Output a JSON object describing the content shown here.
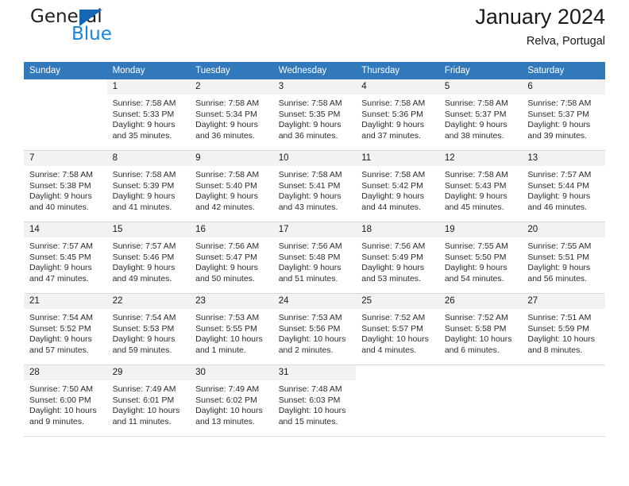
{
  "brand": {
    "name_top": "General",
    "name_bottom": "Blue",
    "triangle_color": "#1567b2",
    "blue_color": "#1a86d8",
    "dark_color": "#231f20"
  },
  "header": {
    "title": "January 2024",
    "subtitle": "Relva, Portugal"
  },
  "theme": {
    "header_band": "#3279bb",
    "daynum_band": "#f2f2f2",
    "row_divider": "#d9d9d9",
    "text": "#1a1a1a"
  },
  "weekdays": [
    "Sunday",
    "Monday",
    "Tuesday",
    "Wednesday",
    "Thursday",
    "Friday",
    "Saturday"
  ],
  "weeks": [
    [
      {
        "blank": true
      },
      {
        "day": "1",
        "sunrise": "Sunrise: 7:58 AM",
        "sunset": "Sunset: 5:33 PM",
        "daylight1": "Daylight: 9 hours",
        "daylight2": "and 35 minutes."
      },
      {
        "day": "2",
        "sunrise": "Sunrise: 7:58 AM",
        "sunset": "Sunset: 5:34 PM",
        "daylight1": "Daylight: 9 hours",
        "daylight2": "and 36 minutes."
      },
      {
        "day": "3",
        "sunrise": "Sunrise: 7:58 AM",
        "sunset": "Sunset: 5:35 PM",
        "daylight1": "Daylight: 9 hours",
        "daylight2": "and 36 minutes."
      },
      {
        "day": "4",
        "sunrise": "Sunrise: 7:58 AM",
        "sunset": "Sunset: 5:36 PM",
        "daylight1": "Daylight: 9 hours",
        "daylight2": "and 37 minutes."
      },
      {
        "day": "5",
        "sunrise": "Sunrise: 7:58 AM",
        "sunset": "Sunset: 5:37 PM",
        "daylight1": "Daylight: 9 hours",
        "daylight2": "and 38 minutes."
      },
      {
        "day": "6",
        "sunrise": "Sunrise: 7:58 AM",
        "sunset": "Sunset: 5:37 PM",
        "daylight1": "Daylight: 9 hours",
        "daylight2": "and 39 minutes."
      }
    ],
    [
      {
        "day": "7",
        "sunrise": "Sunrise: 7:58 AM",
        "sunset": "Sunset: 5:38 PM",
        "daylight1": "Daylight: 9 hours",
        "daylight2": "and 40 minutes."
      },
      {
        "day": "8",
        "sunrise": "Sunrise: 7:58 AM",
        "sunset": "Sunset: 5:39 PM",
        "daylight1": "Daylight: 9 hours",
        "daylight2": "and 41 minutes."
      },
      {
        "day": "9",
        "sunrise": "Sunrise: 7:58 AM",
        "sunset": "Sunset: 5:40 PM",
        "daylight1": "Daylight: 9 hours",
        "daylight2": "and 42 minutes."
      },
      {
        "day": "10",
        "sunrise": "Sunrise: 7:58 AM",
        "sunset": "Sunset: 5:41 PM",
        "daylight1": "Daylight: 9 hours",
        "daylight2": "and 43 minutes."
      },
      {
        "day": "11",
        "sunrise": "Sunrise: 7:58 AM",
        "sunset": "Sunset: 5:42 PM",
        "daylight1": "Daylight: 9 hours",
        "daylight2": "and 44 minutes."
      },
      {
        "day": "12",
        "sunrise": "Sunrise: 7:58 AM",
        "sunset": "Sunset: 5:43 PM",
        "daylight1": "Daylight: 9 hours",
        "daylight2": "and 45 minutes."
      },
      {
        "day": "13",
        "sunrise": "Sunrise: 7:57 AM",
        "sunset": "Sunset: 5:44 PM",
        "daylight1": "Daylight: 9 hours",
        "daylight2": "and 46 minutes."
      }
    ],
    [
      {
        "day": "14",
        "sunrise": "Sunrise: 7:57 AM",
        "sunset": "Sunset: 5:45 PM",
        "daylight1": "Daylight: 9 hours",
        "daylight2": "and 47 minutes."
      },
      {
        "day": "15",
        "sunrise": "Sunrise: 7:57 AM",
        "sunset": "Sunset: 5:46 PM",
        "daylight1": "Daylight: 9 hours",
        "daylight2": "and 49 minutes."
      },
      {
        "day": "16",
        "sunrise": "Sunrise: 7:56 AM",
        "sunset": "Sunset: 5:47 PM",
        "daylight1": "Daylight: 9 hours",
        "daylight2": "and 50 minutes."
      },
      {
        "day": "17",
        "sunrise": "Sunrise: 7:56 AM",
        "sunset": "Sunset: 5:48 PM",
        "daylight1": "Daylight: 9 hours",
        "daylight2": "and 51 minutes."
      },
      {
        "day": "18",
        "sunrise": "Sunrise: 7:56 AM",
        "sunset": "Sunset: 5:49 PM",
        "daylight1": "Daylight: 9 hours",
        "daylight2": "and 53 minutes."
      },
      {
        "day": "19",
        "sunrise": "Sunrise: 7:55 AM",
        "sunset": "Sunset: 5:50 PM",
        "daylight1": "Daylight: 9 hours",
        "daylight2": "and 54 minutes."
      },
      {
        "day": "20",
        "sunrise": "Sunrise: 7:55 AM",
        "sunset": "Sunset: 5:51 PM",
        "daylight1": "Daylight: 9 hours",
        "daylight2": "and 56 minutes."
      }
    ],
    [
      {
        "day": "21",
        "sunrise": "Sunrise: 7:54 AM",
        "sunset": "Sunset: 5:52 PM",
        "daylight1": "Daylight: 9 hours",
        "daylight2": "and 57 minutes."
      },
      {
        "day": "22",
        "sunrise": "Sunrise: 7:54 AM",
        "sunset": "Sunset: 5:53 PM",
        "daylight1": "Daylight: 9 hours",
        "daylight2": "and 59 minutes."
      },
      {
        "day": "23",
        "sunrise": "Sunrise: 7:53 AM",
        "sunset": "Sunset: 5:55 PM",
        "daylight1": "Daylight: 10 hours",
        "daylight2": "and 1 minute."
      },
      {
        "day": "24",
        "sunrise": "Sunrise: 7:53 AM",
        "sunset": "Sunset: 5:56 PM",
        "daylight1": "Daylight: 10 hours",
        "daylight2": "and 2 minutes."
      },
      {
        "day": "25",
        "sunrise": "Sunrise: 7:52 AM",
        "sunset": "Sunset: 5:57 PM",
        "daylight1": "Daylight: 10 hours",
        "daylight2": "and 4 minutes."
      },
      {
        "day": "26",
        "sunrise": "Sunrise: 7:52 AM",
        "sunset": "Sunset: 5:58 PM",
        "daylight1": "Daylight: 10 hours",
        "daylight2": "and 6 minutes."
      },
      {
        "day": "27",
        "sunrise": "Sunrise: 7:51 AM",
        "sunset": "Sunset: 5:59 PM",
        "daylight1": "Daylight: 10 hours",
        "daylight2": "and 8 minutes."
      }
    ],
    [
      {
        "day": "28",
        "sunrise": "Sunrise: 7:50 AM",
        "sunset": "Sunset: 6:00 PM",
        "daylight1": "Daylight: 10 hours",
        "daylight2": "and 9 minutes."
      },
      {
        "day": "29",
        "sunrise": "Sunrise: 7:49 AM",
        "sunset": "Sunset: 6:01 PM",
        "daylight1": "Daylight: 10 hours",
        "daylight2": "and 11 minutes."
      },
      {
        "day": "30",
        "sunrise": "Sunrise: 7:49 AM",
        "sunset": "Sunset: 6:02 PM",
        "daylight1": "Daylight: 10 hours",
        "daylight2": "and 13 minutes."
      },
      {
        "day": "31",
        "sunrise": "Sunrise: 7:48 AM",
        "sunset": "Sunset: 6:03 PM",
        "daylight1": "Daylight: 10 hours",
        "daylight2": "and 15 minutes."
      },
      {
        "blank": true
      },
      {
        "blank": true
      },
      {
        "blank": true
      }
    ]
  ]
}
